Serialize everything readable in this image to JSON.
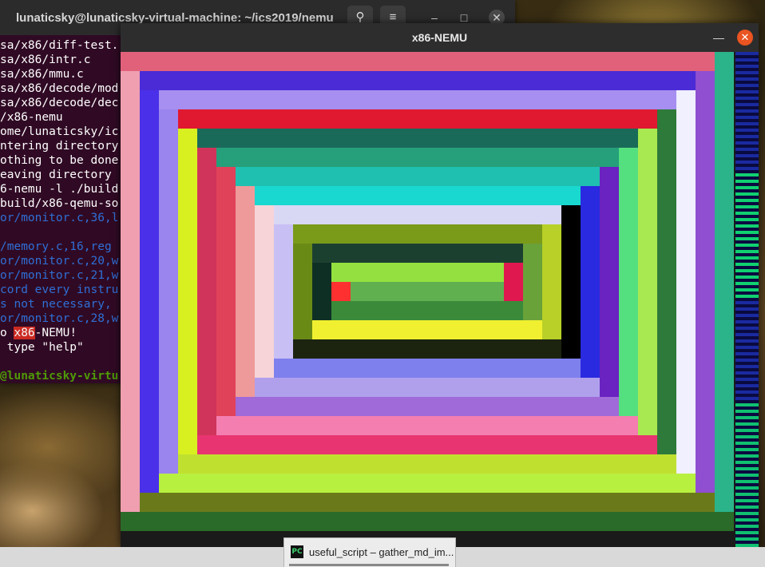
{
  "terminal": {
    "title": "lunaticsky@lunaticsky-virtual-machine: ~/ics2019/nemu",
    "search_icon": "search-icon",
    "menu_icon": "hamburger-menu-icon",
    "lines": [
      {
        "text": "sa/x86/diff-test.",
        "style": "white"
      },
      {
        "text": "sa/x86/intr.c",
        "style": "white"
      },
      {
        "text": "sa/x86/mmu.c",
        "style": "white"
      },
      {
        "text": "sa/x86/decode/mod",
        "style": "white"
      },
      {
        "text": "sa/x86/decode/dec",
        "style": "white"
      },
      {
        "text": "/x86-nemu",
        "style": "white"
      },
      {
        "text": "ome/lunaticsky/ic",
        "style": "white"
      },
      {
        "text": "ntering directory",
        "style": "white"
      },
      {
        "text": "othing to be done",
        "style": "white"
      },
      {
        "text": "eaving directory",
        "style": "white"
      },
      {
        "text": "6-nemu -l ./build",
        "style": "white"
      },
      {
        "text": "build/x86-qemu-so",
        "style": "white"
      },
      {
        "text": "or/monitor.c,36,l",
        "style": "blue"
      },
      {
        "text": "",
        "style": "white"
      },
      {
        "text": "/memory.c,16,reg",
        "style": "blue"
      },
      {
        "text": "or/monitor.c,20,w",
        "style": "blue"
      },
      {
        "text": "or/monitor.c,21,w",
        "style": "blue"
      },
      {
        "text": "cord every instru",
        "style": "blue"
      },
      {
        "text": "s not necessary,",
        "style": "blue"
      },
      {
        "text": "or/monitor.c,28,w",
        "style": "blue"
      },
      {
        "text": "",
        "style": "white"
      },
      {
        "text": " type \"help\"",
        "style": "white"
      },
      {
        "text": "",
        "style": "white"
      },
      {
        "text": "@lunaticsky-virtu",
        "style": "green"
      }
    ],
    "welcome_prefix": "o ",
    "welcome_highlight": "x86",
    "welcome_suffix": "-NEMU!"
  },
  "nemu": {
    "title": "x86-NEMU",
    "minimize_label": "—",
    "close_label": "✕"
  },
  "taskbar": {
    "item_label": "useful_script – gather_md_im...",
    "item_icon": "pycharm-icon",
    "item_icon_text": "PC"
  }
}
